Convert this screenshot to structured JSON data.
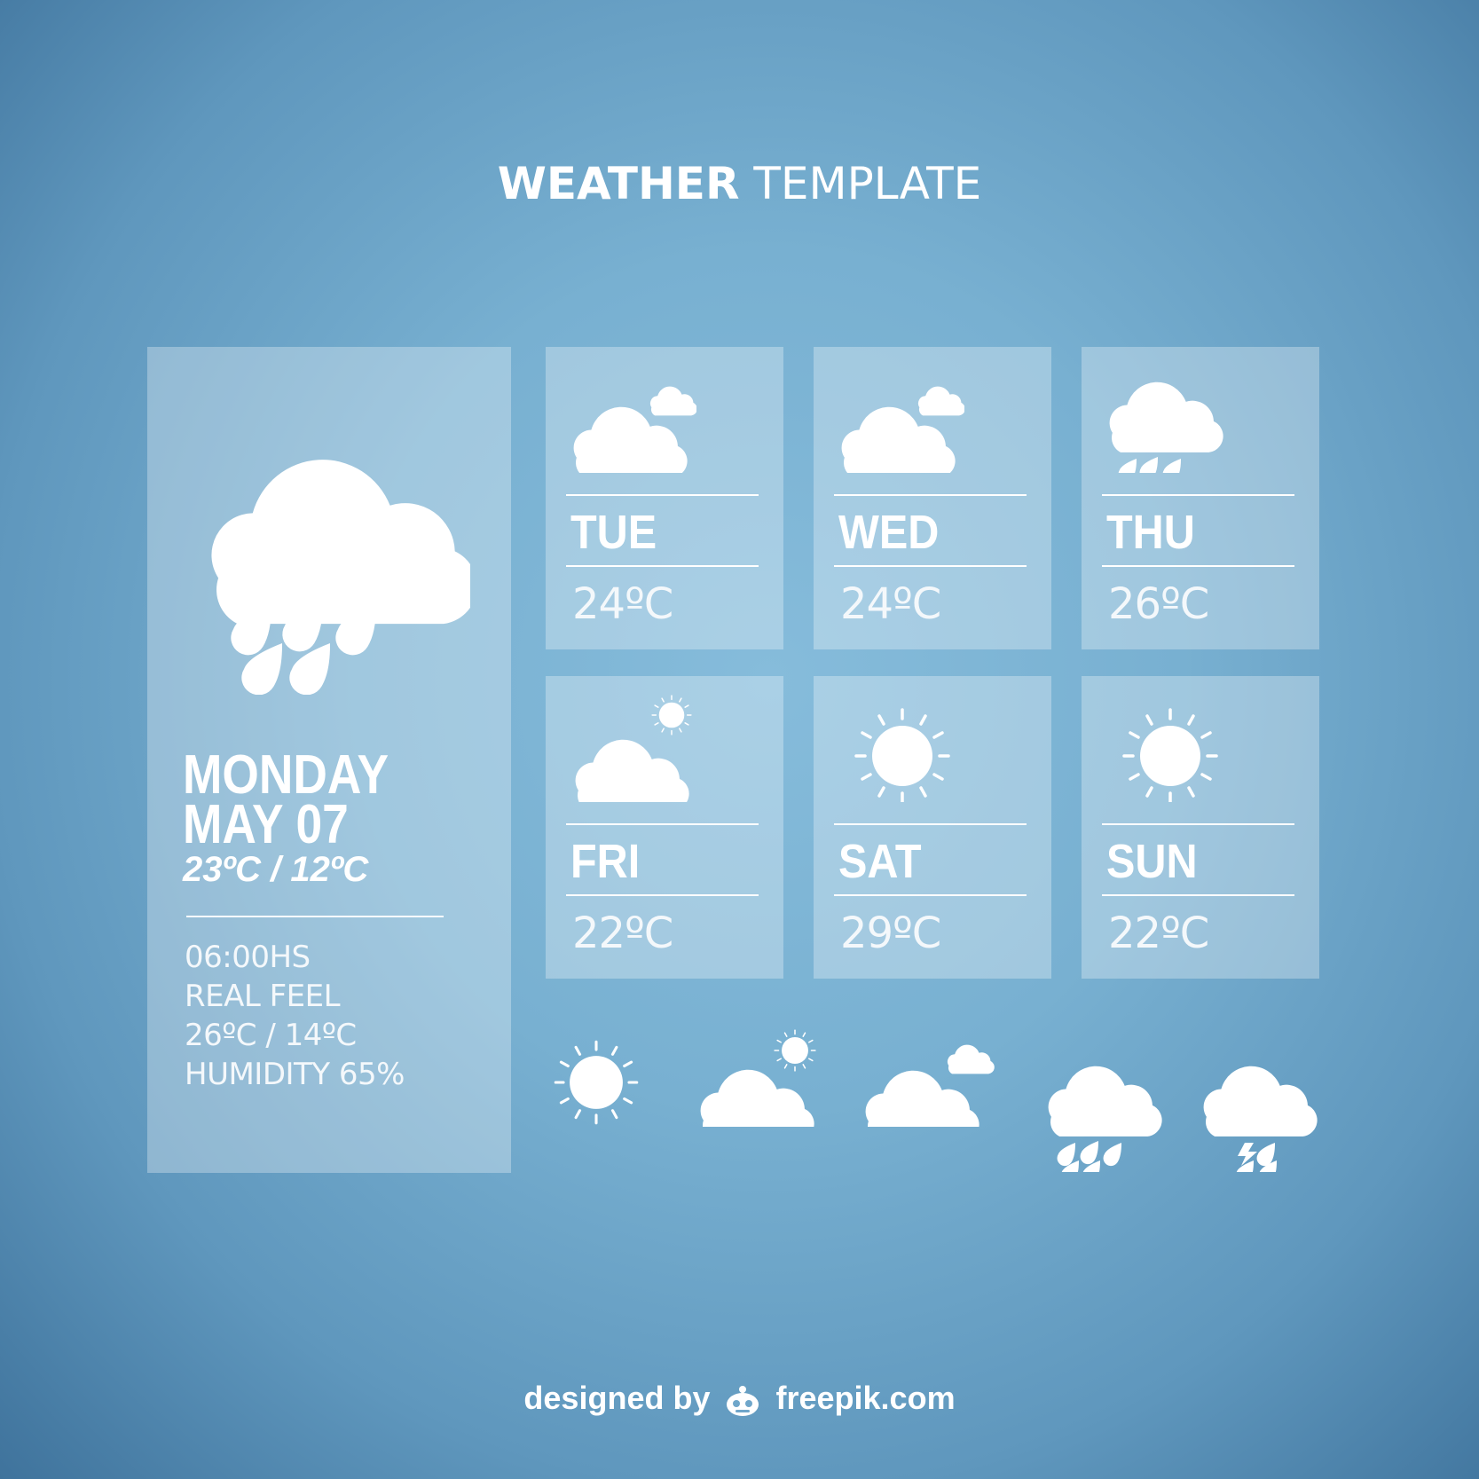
{
  "header": {
    "title_bold": "WEATHER",
    "title_light": "TEMPLATE"
  },
  "today": {
    "icon": "rain-cloud-icon",
    "day": "MONDAY",
    "date": "MAY 07",
    "temp_range": "23ºC / 12ºC",
    "time": "06:00HS",
    "real_feel_label": "REAL FEEL",
    "real_feel": "26ºC / 14ºC",
    "humidity": "HUMIDITY 65%"
  },
  "forecast": [
    {
      "day": "TUE",
      "temp": "24ºC",
      "icon": "partly-cloudy-icon"
    },
    {
      "day": "WED",
      "temp": "24ºC",
      "icon": "partly-cloudy-icon"
    },
    {
      "day": "THU",
      "temp": "26ºC",
      "icon": "rain-cloud-icon"
    },
    {
      "day": "FRI",
      "temp": "22ºC",
      "icon": "cloud-sun-icon"
    },
    {
      "day": "SAT",
      "temp": "29ºC",
      "icon": "sun-icon"
    },
    {
      "day": "SUN",
      "temp": "22ºC",
      "icon": "sun-icon"
    }
  ],
  "legend_icons": [
    "sun-icon",
    "cloud-sun-icon",
    "cloudy-icon",
    "rain-cloud-icon",
    "storm-cloud-icon"
  ],
  "footer": {
    "prefix": "designed by",
    "brand": "freepik.com"
  },
  "colors": {
    "background": "#78b0d1",
    "card": "rgba(255,255,255,0.30)",
    "text": "#ffffff"
  }
}
